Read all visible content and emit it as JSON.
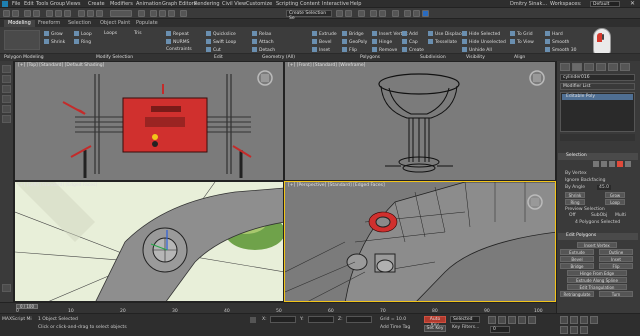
{
  "menu": [
    "File",
    "Edit",
    "Tools",
    "Group",
    "Views",
    "Create",
    "Modifiers",
    "Animation",
    "Graph Editors",
    "Rendering",
    "Civil View",
    "Customize",
    "Scripting",
    "Content",
    "Interactive",
    "Help"
  ],
  "user": "Dmitry Sinak...",
  "workspace_label": "Workspaces:",
  "workspace_value": "Default",
  "selection_set": "Create Selection Se",
  "ribbon_tabs": [
    "Modeling",
    "Freeform",
    "Selection",
    "Object Paint",
    "Populate"
  ],
  "ribbon": {
    "polygon_modeling": "Polygon Modeling",
    "modify_selection": "Modify Selection",
    "edit": "Edit",
    "geometry_all": "Geometry (All)",
    "polygons": "Polygons",
    "loops_label": "Loops",
    "tris_label": "Tris",
    "subdivision": "Subdivision",
    "visibility": "Visibility",
    "align": "Align",
    "items_col1": [
      "Grow",
      "Shrink"
    ],
    "items_col2": [
      "Loop",
      "Ring"
    ],
    "items_col3": [
      "Repeat",
      "NURMS",
      "Constraints"
    ],
    "items_col4": [
      "Quickslice",
      "Swift Loop",
      "Cut",
      "P Connect"
    ],
    "items_col5": [
      "Relax",
      "Attach",
      "Detach"
    ],
    "items_col6": [
      "Extrude",
      "Bevel",
      "Inset"
    ],
    "items_col7": [
      "Bridge",
      "GeoPoly",
      "Flip"
    ],
    "items_col8": [
      "Insert Vertex",
      "Hinge",
      "Remove"
    ],
    "items_col9": [
      "Add",
      "Cap",
      "Create"
    ],
    "items_col10": [
      "Use Displace",
      "Tessellate",
      "Use Displace"
    ],
    "items_col11": [
      "Hide Selected",
      "Hide Unselected",
      "Unhide All"
    ],
    "items_col12": [
      "To Grid",
      "To View",
      "Smooth 30"
    ],
    "items_col13": [
      "Hard",
      "Smooth",
      "Smooth 30"
    ]
  },
  "viewports": {
    "top_left": "[+] [Top] [Standard] [Default Shading]",
    "top_right": "[+] [Front] [Standard] [Wireframe]",
    "bottom_left": "[+] [Left] [Standard] [Edged Faces]",
    "bottom_right": "[+] [Perspective] [Standard] [Edged Faces]"
  },
  "right_panel": {
    "object_name": "cylinder016",
    "modifier_list": "Modifier List",
    "stack_item": "Editable Poly",
    "selection_title": "Selection",
    "by_vertex": "By Vertex",
    "ignore_backfacing": "Ignore Backfacing",
    "by_angle": "By Angle",
    "by_angle_value": "45.0",
    "shrink": "Shrink",
    "grow": "Grow",
    "ring": "Ring",
    "loop": "Loop",
    "preview_selection": "Preview Selection",
    "preview_off": "Off",
    "preview_subobj": "SubObj",
    "preview_multi": "Multi",
    "polygons_selected": "4 Polygons Selected",
    "edit_polygons_title": "Edit Polygons",
    "insert_vertex": "Insert Vertex",
    "extrude": "Extrude",
    "outline": "Outline",
    "bevel": "Bevel",
    "inset": "Inset",
    "bridge": "Bridge",
    "flip": "Flip",
    "hinge_from_edge": "Hinge From Edge",
    "extrude_along_spline": "Extrude Along Spline",
    "edit_triangulation": "Edit Triangulation",
    "retriangulate": "Retriangulate",
    "turn": "Turn"
  },
  "timeline": {
    "frame_display": "0 / 100",
    "ticks": [
      "0",
      "10",
      "20",
      "30",
      "40",
      "50",
      "60",
      "70",
      "80",
      "90",
      "100"
    ]
  },
  "status": {
    "objects_selected": "1 Object Selected",
    "prompt": "Click or click-and-drag to select objects",
    "script_label": "MAXScript Mi",
    "x_label": "X:",
    "y_label": "Y:",
    "z_label": "Z:",
    "grid": "Grid = 10.0",
    "add_time_tag": "Add Time Tag",
    "auto_key": "Auto Key",
    "set_key": "Set Key",
    "selected": "Selected",
    "key_filters": "Key Filters...",
    "frame": "0"
  },
  "colors": {
    "selection_red": "#d0302e",
    "active_border": "#f2c419",
    "vp_bg": "#7a7a7a"
  }
}
